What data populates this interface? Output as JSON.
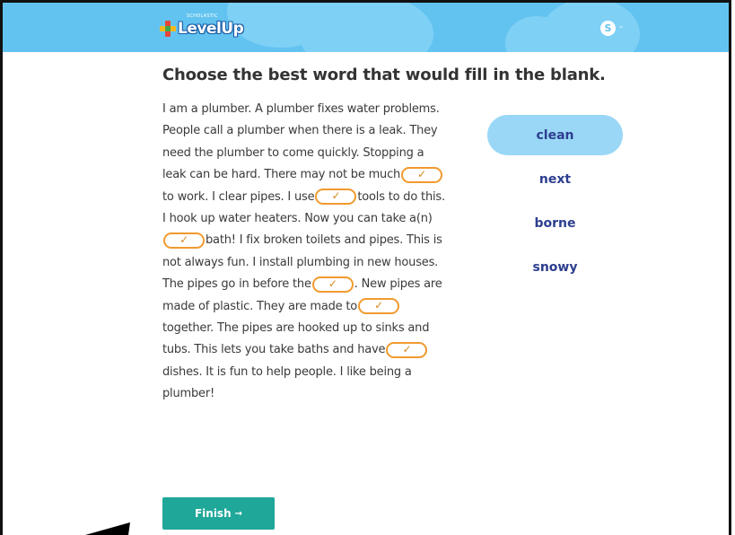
{
  "header": {
    "logo_superscript": "SCHOLASTIC",
    "logo_text": "LevelUp",
    "avatar_letter": "S",
    "avatar_menu": "-"
  },
  "question": "Choose the best word that would fill in the blank.",
  "passage_lines": [
    [
      "I am a plumber. A plumber fixes water problems."
    ],
    [
      "People call a plumber when there is a leak. They"
    ],
    [
      "need the plumber to come quickly. Stopping a"
    ],
    [
      "leak can be hard. There may not be much",
      "BLANK",
      ""
    ],
    [
      "to work. I clear pipes. I use",
      "BLANK",
      "tools to do this."
    ],
    [
      "I hook up water heaters. Now you can take a(n)"
    ],
    [
      "",
      "BLANK",
      "bath! I fix broken toilets and pipes. This is"
    ],
    [
      "not always fun. I install plumbing in new houses."
    ],
    [
      "The pipes go in before the",
      "BLANK",
      ". New pipes are"
    ],
    [
      "made of plastic. They are made to",
      "BLANK",
      ""
    ],
    [
      "together. The pipes are hooked up to sinks and"
    ],
    [
      "tubs. This lets you take baths and have",
      "BLANK",
      ""
    ],
    [
      "dishes. It is fun to help people. I like being a"
    ],
    [
      "plumber!"
    ]
  ],
  "blank_check": "✓",
  "options": [
    {
      "label": "clean",
      "selected": true
    },
    {
      "label": "next",
      "selected": false
    },
    {
      "label": "borne",
      "selected": false
    },
    {
      "label": "snowy",
      "selected": false
    }
  ],
  "finish_button": {
    "label": "Finish",
    "arrow": "→"
  },
  "colors": {
    "header_bg": "#63c3f0",
    "blank_border": "#f19a2e",
    "selected_option": "#9ad7f6",
    "finish_bg": "#1fa79a",
    "option_text": "#2c3e8f"
  }
}
